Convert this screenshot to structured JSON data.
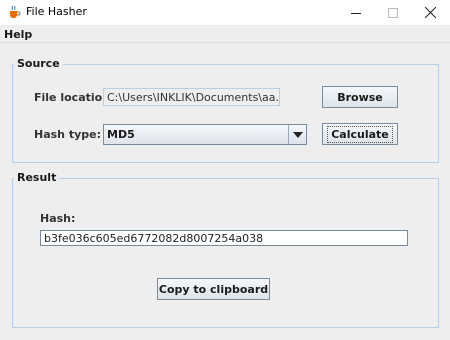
{
  "window": {
    "title": "File Hasher"
  },
  "icons": {
    "app": "app-coffee-icon",
    "minimize": "minimize-icon",
    "maximize": "maximize-icon",
    "close": "close-icon",
    "dropdown": "chevron-down-icon"
  },
  "menu": {
    "help_label": "Help"
  },
  "source": {
    "group_title": "Source",
    "file_location_label": "File location:",
    "file_location_value": "C:\\Users\\INKLIK\\Documents\\aa.txt",
    "browse_label": "Browse",
    "hash_type_label": "Hash type:",
    "hash_type_value": "MD5",
    "calculate_label": "Calculate"
  },
  "result": {
    "group_title": "Result",
    "hash_label": "Hash:",
    "hash_value": "b3fe036c605ed6772082d8007254a038",
    "copy_label": "Copy to clipboard"
  },
  "colors": {
    "background": "#eeeeee",
    "group_border": "#b8cfe5",
    "titlebar": "#ffffff"
  }
}
